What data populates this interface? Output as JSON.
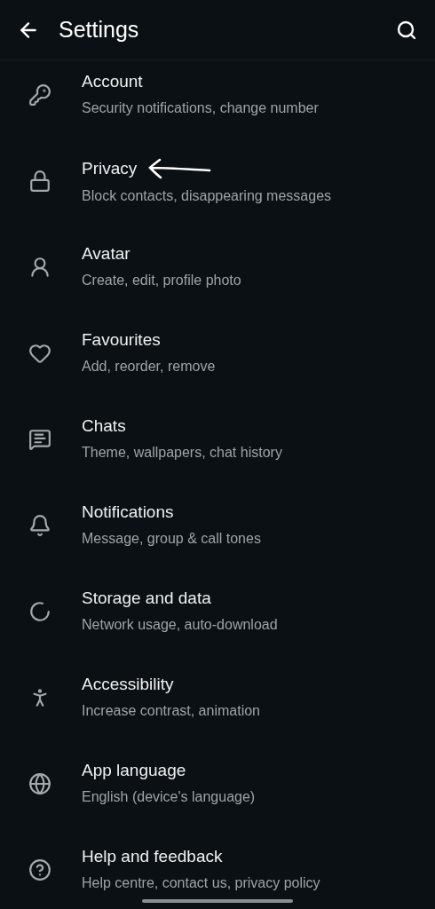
{
  "header": {
    "title": "Settings"
  },
  "items": [
    {
      "title": "Account",
      "subtitle": "Security notifications, change number",
      "marked": false
    },
    {
      "title": "Privacy",
      "subtitle": "Block contacts, disappearing messages",
      "marked": true
    },
    {
      "title": "Avatar",
      "subtitle": "Create, edit, profile photo",
      "marked": false
    },
    {
      "title": "Favourites",
      "subtitle": "Add, reorder, remove",
      "marked": false
    },
    {
      "title": "Chats",
      "subtitle": "Theme, wallpapers, chat history",
      "marked": false
    },
    {
      "title": "Notifications",
      "subtitle": "Message, group & call tones",
      "marked": false
    },
    {
      "title": "Storage and data",
      "subtitle": "Network usage, auto-download",
      "marked": false
    },
    {
      "title": "Accessibility",
      "subtitle": "Increase contrast, animation",
      "marked": false
    },
    {
      "title": "App language",
      "subtitle": "English (device's language)",
      "marked": false
    },
    {
      "title": "Help and feedback",
      "subtitle": "Help centre, contact us, privacy policy",
      "marked": false
    }
  ]
}
